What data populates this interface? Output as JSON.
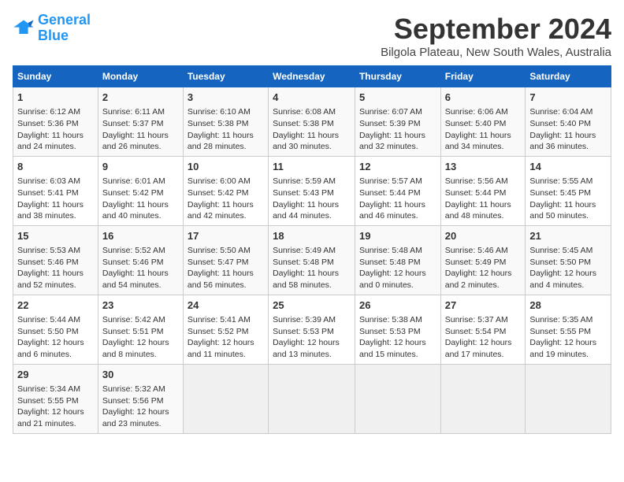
{
  "logo": {
    "line1": "General",
    "line2": "Blue"
  },
  "title": "September 2024",
  "subtitle": "Bilgola Plateau, New South Wales, Australia",
  "days_of_week": [
    "Sunday",
    "Monday",
    "Tuesday",
    "Wednesday",
    "Thursday",
    "Friday",
    "Saturday"
  ],
  "weeks": [
    [
      {
        "day": "1",
        "sunrise": "6:12 AM",
        "sunset": "5:36 PM",
        "daylight": "11 hours and 24 minutes."
      },
      {
        "day": "2",
        "sunrise": "6:11 AM",
        "sunset": "5:37 PM",
        "daylight": "11 hours and 26 minutes."
      },
      {
        "day": "3",
        "sunrise": "6:10 AM",
        "sunset": "5:38 PM",
        "daylight": "11 hours and 28 minutes."
      },
      {
        "day": "4",
        "sunrise": "6:08 AM",
        "sunset": "5:38 PM",
        "daylight": "11 hours and 30 minutes."
      },
      {
        "day": "5",
        "sunrise": "6:07 AM",
        "sunset": "5:39 PM",
        "daylight": "11 hours and 32 minutes."
      },
      {
        "day": "6",
        "sunrise": "6:06 AM",
        "sunset": "5:40 PM",
        "daylight": "11 hours and 34 minutes."
      },
      {
        "day": "7",
        "sunrise": "6:04 AM",
        "sunset": "5:40 PM",
        "daylight": "11 hours and 36 minutes."
      }
    ],
    [
      {
        "day": "8",
        "sunrise": "6:03 AM",
        "sunset": "5:41 PM",
        "daylight": "11 hours and 38 minutes."
      },
      {
        "day": "9",
        "sunrise": "6:01 AM",
        "sunset": "5:42 PM",
        "daylight": "11 hours and 40 minutes."
      },
      {
        "day": "10",
        "sunrise": "6:00 AM",
        "sunset": "5:42 PM",
        "daylight": "11 hours and 42 minutes."
      },
      {
        "day": "11",
        "sunrise": "5:59 AM",
        "sunset": "5:43 PM",
        "daylight": "11 hours and 44 minutes."
      },
      {
        "day": "12",
        "sunrise": "5:57 AM",
        "sunset": "5:44 PM",
        "daylight": "11 hours and 46 minutes."
      },
      {
        "day": "13",
        "sunrise": "5:56 AM",
        "sunset": "5:44 PM",
        "daylight": "11 hours and 48 minutes."
      },
      {
        "day": "14",
        "sunrise": "5:55 AM",
        "sunset": "5:45 PM",
        "daylight": "11 hours and 50 minutes."
      }
    ],
    [
      {
        "day": "15",
        "sunrise": "5:53 AM",
        "sunset": "5:46 PM",
        "daylight": "11 hours and 52 minutes."
      },
      {
        "day": "16",
        "sunrise": "5:52 AM",
        "sunset": "5:46 PM",
        "daylight": "11 hours and 54 minutes."
      },
      {
        "day": "17",
        "sunrise": "5:50 AM",
        "sunset": "5:47 PM",
        "daylight": "11 hours and 56 minutes."
      },
      {
        "day": "18",
        "sunrise": "5:49 AM",
        "sunset": "5:48 PM",
        "daylight": "11 hours and 58 minutes."
      },
      {
        "day": "19",
        "sunrise": "5:48 AM",
        "sunset": "5:48 PM",
        "daylight": "12 hours and 0 minutes."
      },
      {
        "day": "20",
        "sunrise": "5:46 AM",
        "sunset": "5:49 PM",
        "daylight": "12 hours and 2 minutes."
      },
      {
        "day": "21",
        "sunrise": "5:45 AM",
        "sunset": "5:50 PM",
        "daylight": "12 hours and 4 minutes."
      }
    ],
    [
      {
        "day": "22",
        "sunrise": "5:44 AM",
        "sunset": "5:50 PM",
        "daylight": "12 hours and 6 minutes."
      },
      {
        "day": "23",
        "sunrise": "5:42 AM",
        "sunset": "5:51 PM",
        "daylight": "12 hours and 8 minutes."
      },
      {
        "day": "24",
        "sunrise": "5:41 AM",
        "sunset": "5:52 PM",
        "daylight": "12 hours and 11 minutes."
      },
      {
        "day": "25",
        "sunrise": "5:39 AM",
        "sunset": "5:53 PM",
        "daylight": "12 hours and 13 minutes."
      },
      {
        "day": "26",
        "sunrise": "5:38 AM",
        "sunset": "5:53 PM",
        "daylight": "12 hours and 15 minutes."
      },
      {
        "day": "27",
        "sunrise": "5:37 AM",
        "sunset": "5:54 PM",
        "daylight": "12 hours and 17 minutes."
      },
      {
        "day": "28",
        "sunrise": "5:35 AM",
        "sunset": "5:55 PM",
        "daylight": "12 hours and 19 minutes."
      }
    ],
    [
      {
        "day": "29",
        "sunrise": "5:34 AM",
        "sunset": "5:55 PM",
        "daylight": "12 hours and 21 minutes."
      },
      {
        "day": "30",
        "sunrise": "5:32 AM",
        "sunset": "5:56 PM",
        "daylight": "12 hours and 23 minutes."
      },
      null,
      null,
      null,
      null,
      null
    ]
  ]
}
